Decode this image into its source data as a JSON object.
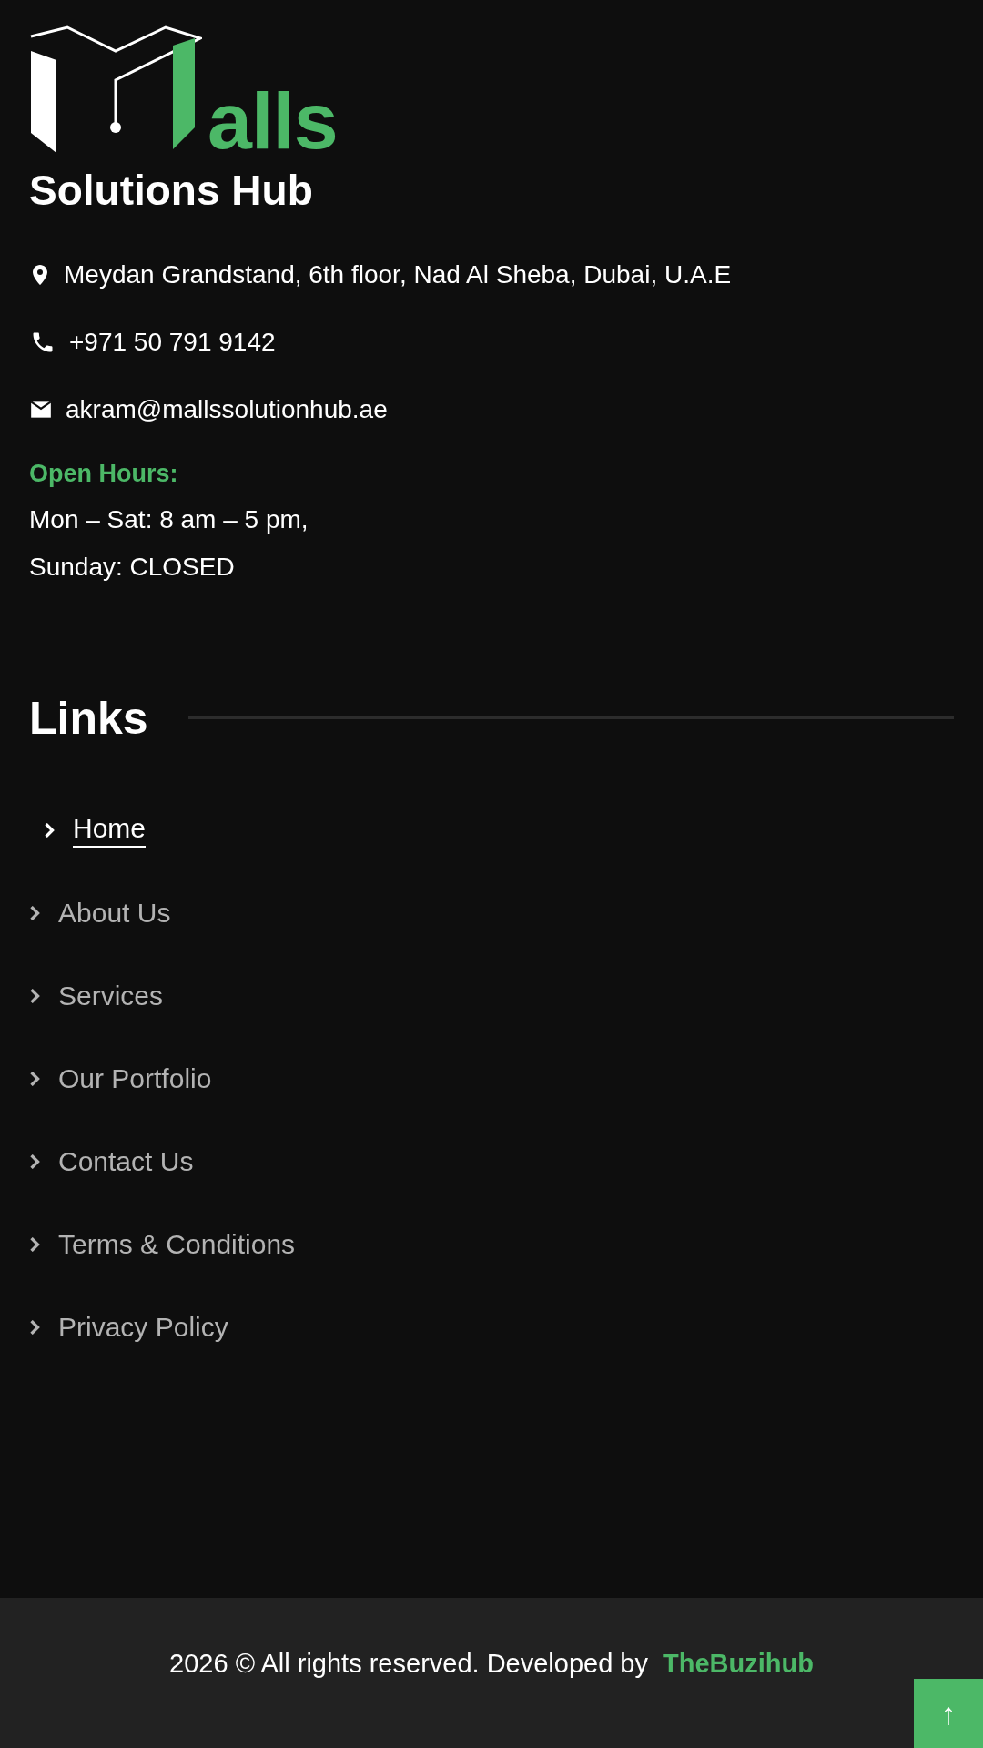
{
  "logo": {
    "word": "alls",
    "subtitle": "Solutions Hub"
  },
  "contact": [
    {
      "kind": "address",
      "text": "Meydan Grandstand, 6th floor, Nad Al Sheba, Dubai, U.A.E"
    },
    {
      "kind": "phone",
      "text": "+971 50 791 9142"
    },
    {
      "kind": "email",
      "text": "akram@mallssolutionhub.ae"
    }
  ],
  "hours": {
    "title": "Open Hours:",
    "lines": [
      "Mon – Sat: 8 am – 5 pm,",
      "Sunday: CLOSED"
    ]
  },
  "links": {
    "title": "Links",
    "items": [
      {
        "label": "Home",
        "selected": true
      },
      {
        "label": "About Us",
        "selected": false
      },
      {
        "label": "Services",
        "selected": false
      },
      {
        "label": "Our Portfolio",
        "selected": false
      },
      {
        "label": "Contact Us",
        "selected": false
      },
      {
        "label": "Terms & Conditions",
        "selected": false
      },
      {
        "label": "Privacy Policy",
        "selected": false
      }
    ]
  },
  "footer": {
    "text": "2026 © All rights reserved. Developed by",
    "link": "TheBuzihub"
  },
  "scroll_top": {
    "label": "↑"
  }
}
